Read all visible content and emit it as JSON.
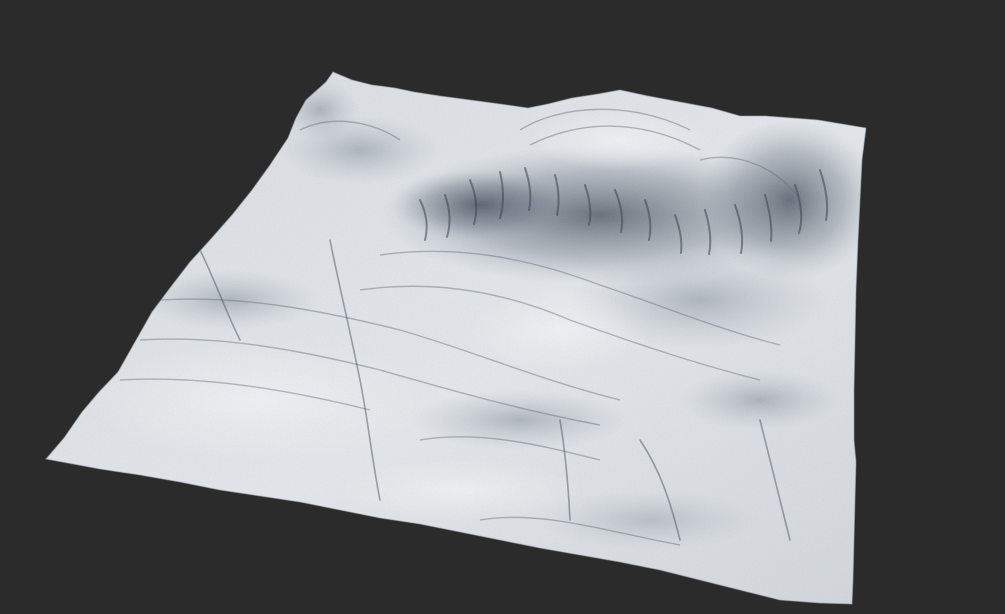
{
  "scene": {
    "subject": "terrain-mesh",
    "background_color": "#2b2b2b",
    "surface_color": "#dfe3e7",
    "shadow_color": "#2a3340"
  }
}
